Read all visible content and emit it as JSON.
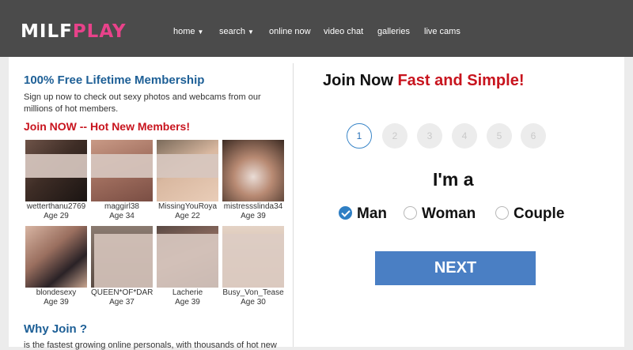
{
  "header": {
    "logo_part1": "MILF",
    "logo_part2": "PLAY",
    "nav": [
      {
        "label": "home",
        "caret": "▼"
      },
      {
        "label": "search",
        "caret": "▼"
      },
      {
        "label": "online now"
      },
      {
        "label": "video chat"
      },
      {
        "label": "galleries"
      },
      {
        "label": "live cams"
      }
    ]
  },
  "left": {
    "membership_title": "100% Free Lifetime Membership",
    "membership_text": "Sign up now to check out sexy photos and webcams from our millions of hot members.",
    "join_title": "Join NOW -- Hot New Members!",
    "members": [
      {
        "name": "wetterthanu2769",
        "age": "Age 29"
      },
      {
        "name": "maggirl38",
        "age": "Age 34"
      },
      {
        "name": "MissingYouRoya",
        "age": "Age 22"
      },
      {
        "name": "mistressslinda34",
        "age": "Age 39"
      },
      {
        "name": "blondesexy",
        "age": "Age 39"
      },
      {
        "name": "QUEEN*OF*DARKN",
        "age": "Age 37"
      },
      {
        "name": "Lacherie",
        "age": "Age 39"
      },
      {
        "name": "Busy_Von_Tease",
        "age": "Age 30"
      }
    ],
    "why_title": "Why Join ?",
    "why_text": "is the fastest growing online personals, with thousands of hot new"
  },
  "right": {
    "heading_dark": "Join Now",
    "heading_red": "Fast and Simple!",
    "steps": [
      "1",
      "2",
      "3",
      "4",
      "5",
      "6"
    ],
    "active_step": "1",
    "iam_label": "I'm a",
    "options": [
      {
        "label": "Man",
        "checked": true
      },
      {
        "label": "Woman",
        "checked": false
      },
      {
        "label": "Couple",
        "checked": false
      }
    ],
    "next_label": "NEXT"
  },
  "colors": {
    "topbar": "#4b4b4b",
    "brand_pink": "#e8428a",
    "link_blue": "#1d5f96",
    "accent_red": "#c8141e",
    "button_blue": "#4a7fc4"
  }
}
